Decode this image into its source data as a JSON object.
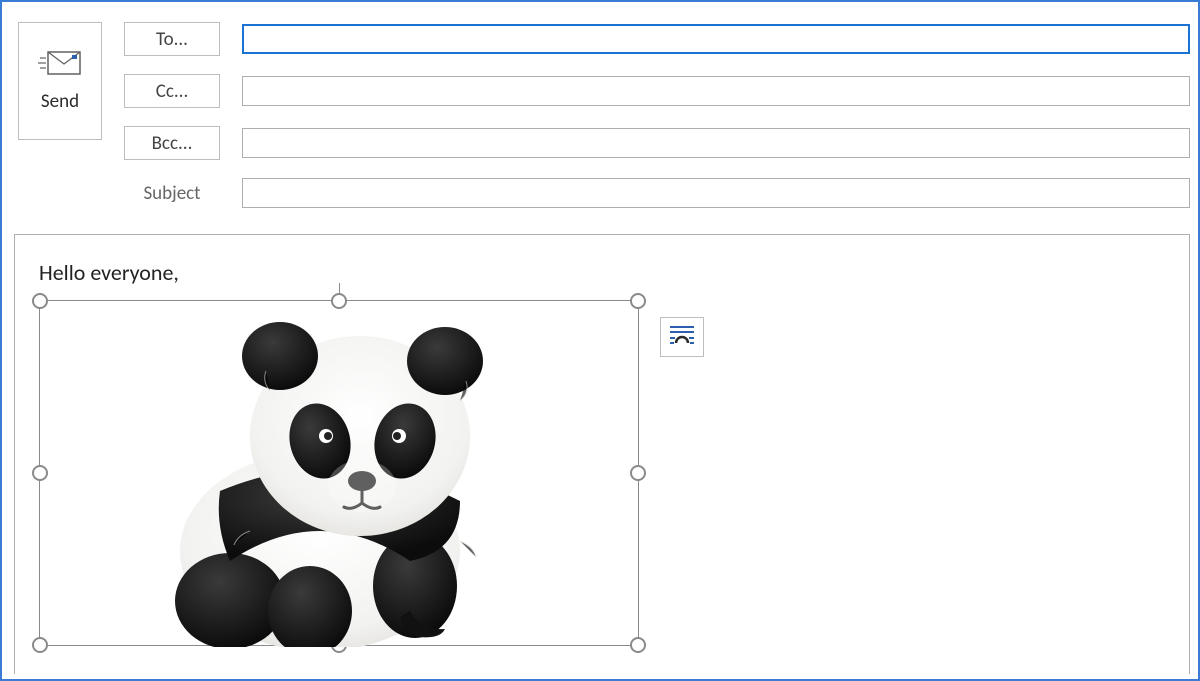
{
  "compose": {
    "send_label": "Send",
    "to_label": "To...",
    "cc_label": "Cc...",
    "bcc_label": "Bcc...",
    "subject_label": "Subject",
    "to_value": "",
    "cc_value": "",
    "bcc_value": "",
    "subject_value": ""
  },
  "body": {
    "greeting": "Hello everyone,",
    "image_description": "panda"
  },
  "icons": {
    "send": "envelope-send-icon",
    "layout": "layout-options-icon"
  }
}
